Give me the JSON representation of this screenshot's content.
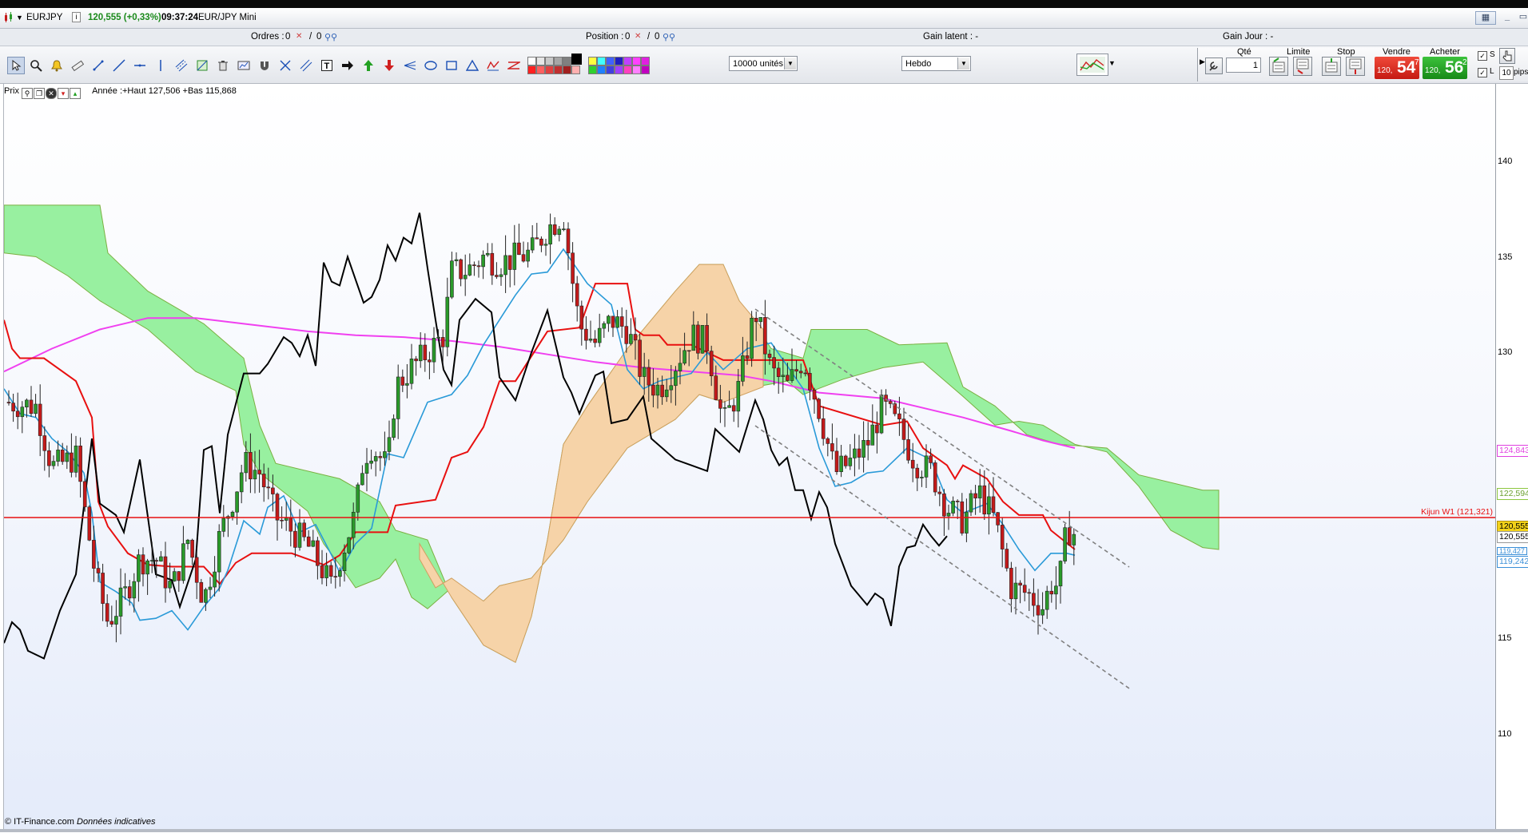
{
  "window": {
    "symbol": "EURJPY",
    "quote": "120,555 (+0,33%)",
    "time": "09:37:24",
    "name": "EUR/JPY Mini",
    "info_icon": "i"
  },
  "infobar": {
    "orders_label": "Ordres :",
    "orders_value": "0",
    "orders_value2": "0",
    "position_label": "Position :",
    "position_value": "0",
    "position_value2": "0",
    "gain_latent": "Gain latent : -",
    "gain_jour": "Gain Jour : -"
  },
  "toolbar": {
    "units_select": "10000 unités",
    "period_select": "Hebdo",
    "qty_label": "Qté",
    "qty_value": "1",
    "limit_label": "Limite",
    "stop_label": "Stop",
    "sell_label": "Vendre",
    "buy_label": "Acheter",
    "sell_small": "120,",
    "sell_big": "54",
    "sell_sup": "7",
    "buy_small": "120,",
    "buy_big": "56",
    "buy_sup": "2",
    "s_label": "S",
    "l_label": "L",
    "pips_value": "10",
    "pips_label": "pips"
  },
  "chart": {
    "price_label": "Prix",
    "year_range": "Année :+Haut 127,506 +Bas 115,868",
    "footer_source": "© IT-Finance.com",
    "footer_note": "Données indicatives",
    "y_ticks": [
      "140",
      "135",
      "130",
      "115",
      "110"
    ],
    "kijun_label": "Kijun W1 (121,321)",
    "price_labels": [
      {
        "text": "124,843",
        "color": "#e040e0"
      },
      {
        "text": "122,594",
        "color": "#8cc63f"
      },
      {
        "text": "120,555",
        "color": "#000000",
        "bg": "#f2d21a"
      },
      {
        "text": "120,555",
        "color": "#000000"
      },
      {
        "text": "119,427",
        "color": "#3a8fd8"
      },
      {
        "text": "119,242",
        "color": "#3a8fd8"
      }
    ],
    "colors": {
      "kumo_bull": "#98f0a0",
      "kumo_bear": "#f6d3a8",
      "kijun": "#e81010",
      "tenkan": "#2a9ad8",
      "chikou": "#000000",
      "sma": "#f040f0",
      "candle_up": "#2a9a2a",
      "candle_down": "#c41a1a",
      "trend": "#808080"
    }
  }
}
